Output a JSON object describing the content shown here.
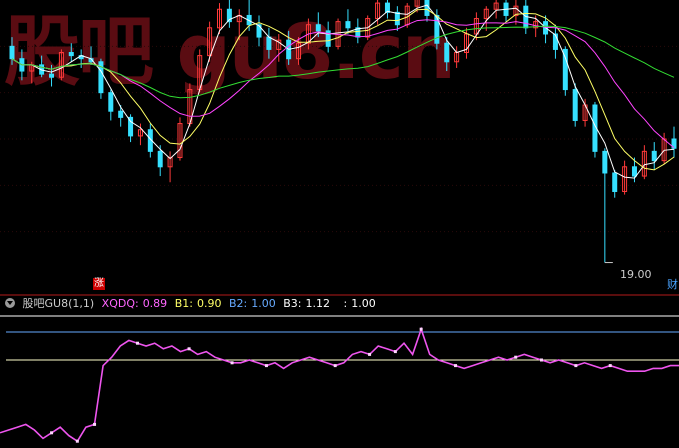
{
  "watermark": "股吧 gu8.cn",
  "indicator_bar": {
    "name": "股吧GU8(1,1)",
    "xqdq_label": "XQDQ:",
    "xqdq_value": "0.89",
    "b1_label": "B1:",
    "b1_value": "0.90",
    "b2_label": "B2:",
    "b2_value": "1.00",
    "b3_label": "B3:",
    "b3_value": "1.12",
    "extra_label": ":",
    "extra_value": "1.00"
  },
  "badges": {
    "zhang": "涨",
    "edge": "财"
  },
  "low_price_label": "19.00",
  "colors": {
    "background": "#000000",
    "up_candle": "#ff3a3a",
    "down_candle": "#36e0ff",
    "ma_white": "#ffffff",
    "ma_yellow": "#ffff66",
    "ma_magenta": "#ff44ff",
    "ma_green": "#33dd33",
    "separator": "#b31a1a",
    "indicator_line": "#ee55ee",
    "b2_line": "#66aaff",
    "b1_line": "#ffffcc",
    "b3_line": "#ffffff",
    "text_xqdq": "#ff66ff",
    "text_b1": "#ffff66",
    "text_b2": "#66aaff",
    "text_b3": "#ffffff"
  },
  "chart_data": [
    {
      "type": "candlestick",
      "title": "",
      "y_low_marked": 19.0,
      "ylim": [
        18.5,
        27.5
      ],
      "candles": [
        [
          26.0,
          26.3,
          25.4,
          25.6
        ],
        [
          25.6,
          25.9,
          24.9,
          25.2
        ],
        [
          25.2,
          25.5,
          24.8,
          25.4
        ],
        [
          25.4,
          25.7,
          25.0,
          25.1
        ],
        [
          25.1,
          25.4,
          24.7,
          25.0
        ],
        [
          25.0,
          25.9,
          24.9,
          25.8
        ],
        [
          25.8,
          26.1,
          25.5,
          25.7
        ],
        [
          25.7,
          25.9,
          25.3,
          25.6
        ],
        [
          25.6,
          26.0,
          25.4,
          25.5
        ],
        [
          25.5,
          25.6,
          24.3,
          24.5
        ],
        [
          24.5,
          24.6,
          23.6,
          23.9
        ],
        [
          23.9,
          24.1,
          23.4,
          23.7
        ],
        [
          23.7,
          23.8,
          22.9,
          23.1
        ],
        [
          23.1,
          23.5,
          22.8,
          23.3
        ],
        [
          23.3,
          23.5,
          22.4,
          22.6
        ],
        [
          22.6,
          22.8,
          21.8,
          22.1
        ],
        [
          22.1,
          22.6,
          21.6,
          22.4
        ],
        [
          22.4,
          23.7,
          22.3,
          23.5
        ],
        [
          23.5,
          24.8,
          23.4,
          24.6
        ],
        [
          24.6,
          25.9,
          24.5,
          25.7
        ],
        [
          25.7,
          26.8,
          25.5,
          26.6
        ],
        [
          26.6,
          27.4,
          26.4,
          27.2
        ],
        [
          27.2,
          27.6,
          26.6,
          26.8
        ],
        [
          26.8,
          27.2,
          26.2,
          27.0
        ],
        [
          27.0,
          27.5,
          26.5,
          26.7
        ],
        [
          26.7,
          27.0,
          26.0,
          26.3
        ],
        [
          26.3,
          26.6,
          25.6,
          25.9
        ],
        [
          25.9,
          26.4,
          25.5,
          26.2
        ],
        [
          26.2,
          26.5,
          25.4,
          25.6
        ],
        [
          25.6,
          26.3,
          25.4,
          26.1
        ],
        [
          26.1,
          26.9,
          25.9,
          26.7
        ],
        [
          26.7,
          27.1,
          26.3,
          26.5
        ],
        [
          26.5,
          26.8,
          25.8,
          26.0
        ],
        [
          26.0,
          26.9,
          25.9,
          26.8
        ],
        [
          26.8,
          27.2,
          26.4,
          26.6
        ],
        [
          26.6,
          26.9,
          26.1,
          26.3
        ],
        [
          26.3,
          27.0,
          26.2,
          26.9
        ],
        [
          26.9,
          27.6,
          26.7,
          27.4
        ],
        [
          27.4,
          27.8,
          26.9,
          27.1
        ],
        [
          27.1,
          27.3,
          26.5,
          26.7
        ],
        [
          26.7,
          27.4,
          26.6,
          27.3
        ],
        [
          27.3,
          27.9,
          27.1,
          27.7
        ],
        [
          27.7,
          27.9,
          26.8,
          27.0
        ],
        [
          27.0,
          27.2,
          25.9,
          26.1
        ],
        [
          26.1,
          26.3,
          25.2,
          25.5
        ],
        [
          25.5,
          26.0,
          25.3,
          25.8
        ],
        [
          25.8,
          26.6,
          25.6,
          26.4
        ],
        [
          26.4,
          27.1,
          26.2,
          26.9
        ],
        [
          26.9,
          27.3,
          26.5,
          27.2
        ],
        [
          27.2,
          27.6,
          26.9,
          27.4
        ],
        [
          27.4,
          27.7,
          26.8,
          27.0
        ],
        [
          27.0,
          27.5,
          26.7,
          27.3
        ],
        [
          27.3,
          27.5,
          26.4,
          26.6
        ],
        [
          26.6,
          27.0,
          26.3,
          26.8
        ],
        [
          26.8,
          27.0,
          26.1,
          26.4
        ],
        [
          26.4,
          26.7,
          25.6,
          25.9
        ],
        [
          25.9,
          26.0,
          24.4,
          24.6
        ],
        [
          24.6,
          24.8,
          23.4,
          23.6
        ],
        [
          23.6,
          24.3,
          23.4,
          24.1
        ],
        [
          24.1,
          24.2,
          22.4,
          22.6
        ],
        [
          22.6,
          22.7,
          19.0,
          21.9
        ],
        [
          21.9,
          22.0,
          21.1,
          21.3
        ],
        [
          21.3,
          22.3,
          21.2,
          22.1
        ],
        [
          22.1,
          22.4,
          21.6,
          21.8
        ],
        [
          21.8,
          22.8,
          21.7,
          22.6
        ],
        [
          22.6,
          22.9,
          22.0,
          22.3
        ],
        [
          22.3,
          23.2,
          22.2,
          23.0
        ],
        [
          23.0,
          23.4,
          22.4,
          22.7
        ]
      ]
    },
    {
      "type": "line",
      "name": "XQDQ",
      "y_levels": {
        "B1": 0.9,
        "B2": 1.0,
        "B3": 1.12
      },
      "ylim": [
        0.6,
        1.05
      ],
      "values": [
        0.64,
        0.65,
        0.66,
        0.67,
        0.65,
        0.62,
        0.64,
        0.66,
        0.63,
        0.61,
        0.66,
        0.67,
        0.88,
        0.91,
        0.95,
        0.97,
        0.96,
        0.95,
        0.96,
        0.94,
        0.95,
        0.93,
        0.94,
        0.92,
        0.93,
        0.91,
        0.9,
        0.89,
        0.89,
        0.9,
        0.89,
        0.88,
        0.89,
        0.87,
        0.89,
        0.9,
        0.91,
        0.9,
        0.89,
        0.88,
        0.89,
        0.92,
        0.93,
        0.92,
        0.95,
        0.94,
        0.93,
        0.96,
        0.92,
        1.01,
        0.92,
        0.9,
        0.89,
        0.88,
        0.87,
        0.88,
        0.89,
        0.9,
        0.91,
        0.9,
        0.91,
        0.92,
        0.91,
        0.9,
        0.89,
        0.9,
        0.89,
        0.88,
        0.89,
        0.88,
        0.87,
        0.88,
        0.87,
        0.86,
        0.86,
        0.86,
        0.87,
        0.87,
        0.88,
        0.88
      ],
      "highlight_points": [
        6,
        9,
        11,
        16,
        22,
        27,
        31,
        39,
        43,
        46,
        49,
        53,
        60,
        63,
        67,
        71
      ]
    }
  ]
}
